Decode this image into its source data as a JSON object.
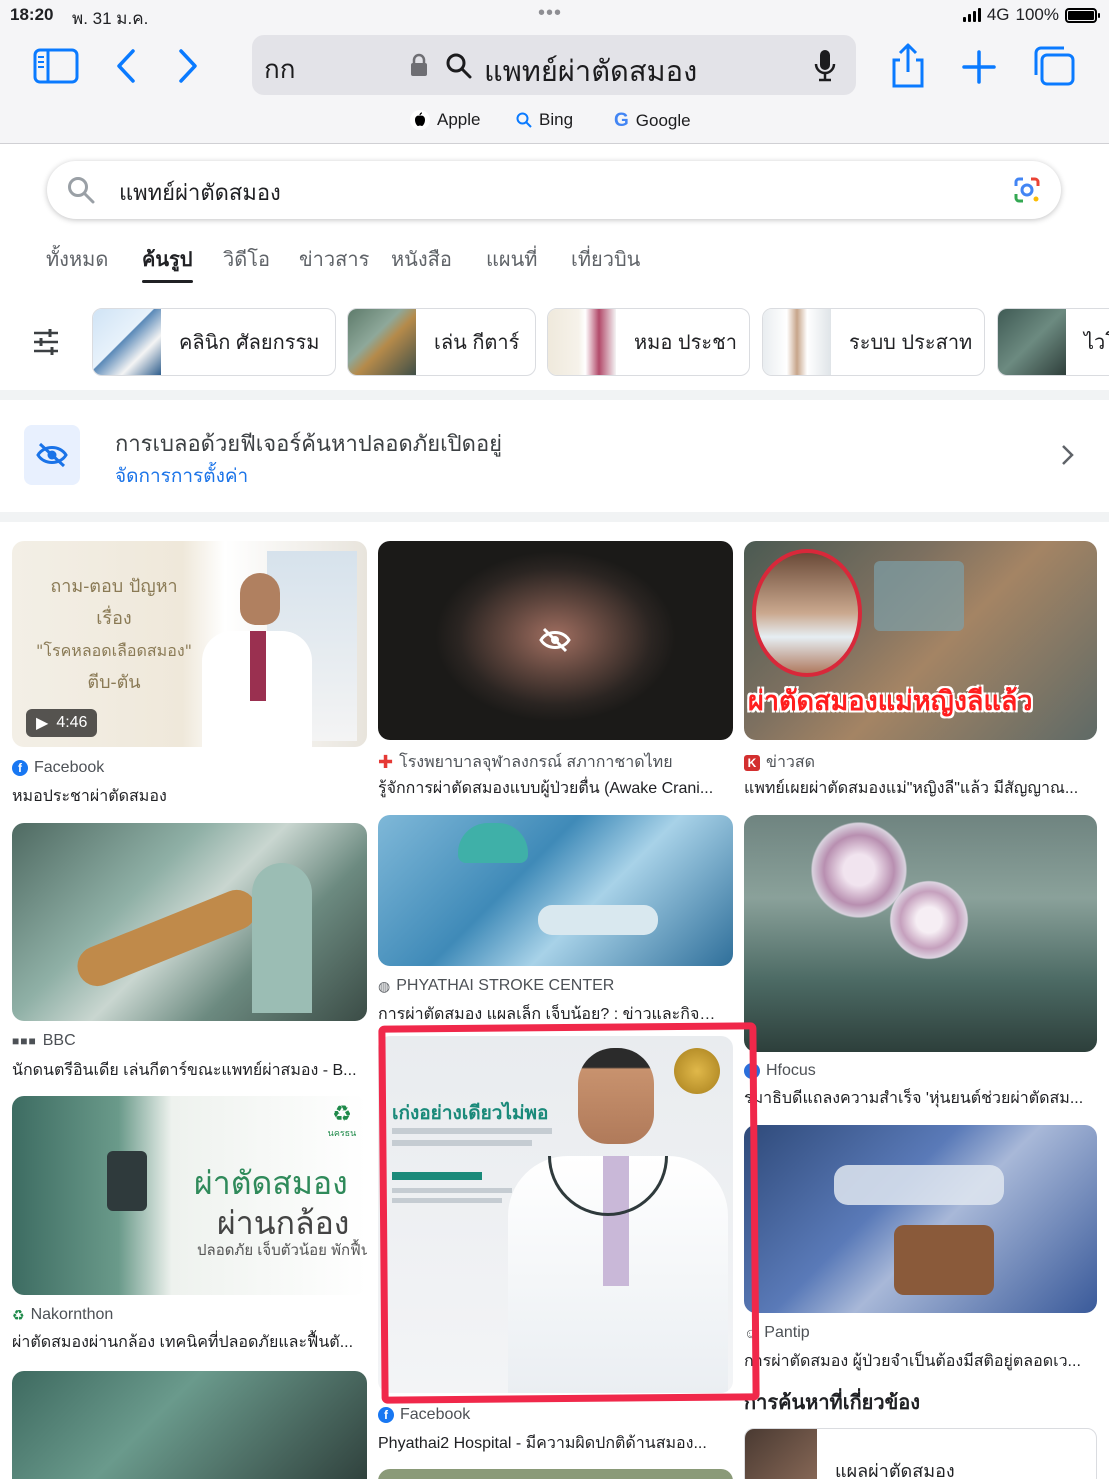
{
  "status": {
    "time": "18:20",
    "date": "พ. 31 ม.ค.",
    "network": "4G",
    "battery": "100%"
  },
  "browser": {
    "text_size_label": "กก",
    "address_query": "แพทย์ผ่าตัดสมอง",
    "favorites": [
      "Apple",
      "Bing",
      "Google"
    ]
  },
  "google": {
    "query": "แพทย์ผ่าตัดสมอง",
    "tabs": [
      "ทั้งหมด",
      "ค้นรูป",
      "วิดีโอ",
      "ข่าวสาร",
      "หนังสือ",
      "แผนที่",
      "เที่ยวบิน"
    ],
    "chips": [
      "คลินิก ศัลยกรรม",
      "เล่น กีตาร์",
      "หมอ ประชา",
      "ระบบ ประสาท",
      "ไวโอ"
    ],
    "safesearch": {
      "title": "การเบลอด้วยฟีเจอร์ค้นหาปลอดภัยเปิดอยู่",
      "link": "จัดการการตั้งค่า"
    },
    "results": [
      {
        "source": "Facebook",
        "title": "หมอประชาผ่าตัดสมอง",
        "duration": "4:46",
        "overlay": [
          "ถาม-ตอบ ปัญหา",
          "เรื่อง",
          "\"โรคหลอดเลือดสมอง\"",
          "ตีบ-ตัน"
        ]
      },
      {
        "source": "โรงพยาบาลจุฬาลงกรณ์ สภากาชาดไทย",
        "title": "รู้จักการผ่าตัดสมองแบบผู้ป่วยตื่น (Awake Crani..."
      },
      {
        "source": "ข่าวสด",
        "title": "แพทย์เผยผ่าตัดสมองแม่\"หญิงลี\"แล้ว มีสัญญาณ...",
        "overlay": "ผ่าตัดสมองแม่หญิงลีแล้ว"
      },
      {
        "source": "BBC",
        "title": "นักดนตรีอินเดีย เล่นกีตาร์ขณะแพทย์ผ่าสมอง - B..."
      },
      {
        "source": "PHYATHAI STROKE CENTER",
        "title": "การผ่าตัดสมอง แผลเล็ก เจ็บน้อย? : ข่าวและกิจก..."
      },
      {
        "source": "Hfocus",
        "title": "รมาธิบดีแถลงความสำเร็จ 'หุ่นยนต์ช่วยผ่าตัดสม..."
      },
      {
        "source": "Nakornthon",
        "title": "ผ่าตัดสมองผ่านกล้อง เทคนิคที่ปลอดภัยและฟื้นตั...",
        "overlay": [
          "ผ่าตัดสมอง",
          "ผ่านกล้อง",
          "ปลอดภัย เจ็บตัวน้อย พักฟื้นสั้น"
        ],
        "brand": "นครธน"
      },
      {
        "source": "Facebook",
        "title": "Phyathai2 Hospital - มีความผิดปกติด้านสมอง...",
        "overlay": "เก่งอย่างเดียวไม่พอ"
      },
      {
        "source": "Pantip",
        "title": "การผ่าตัดสมอง ผู้ป่วยจำเป็นต้องมีสติอยู่ตลอดเว..."
      }
    ],
    "related_heading": "การค้นหาที่เกี่ยวข้อง",
    "related": [
      "แผลผ่าตัดสมอง"
    ]
  },
  "colors": {
    "accent": "#0a7aff",
    "link": "#1a73e8",
    "highlight": "#f0284a"
  }
}
